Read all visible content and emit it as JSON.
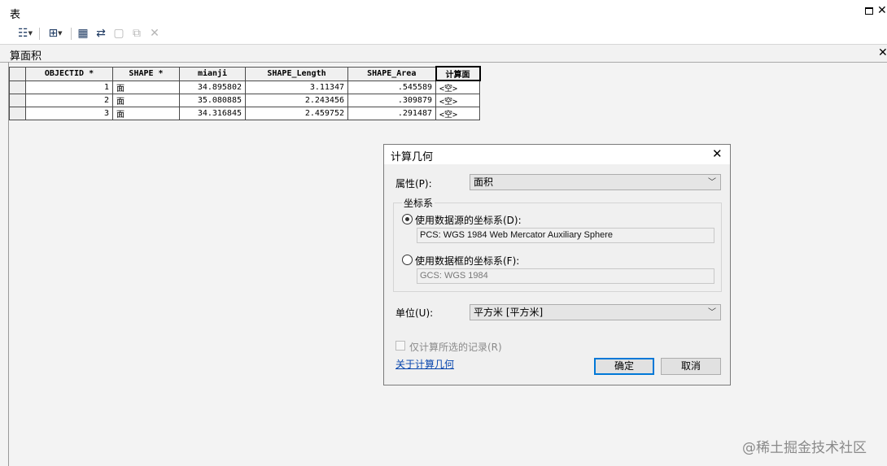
{
  "window": {
    "title": "表"
  },
  "toolbar": {
    "items": [
      {
        "name": "table-options-icon",
        "glyph": "☷",
        "dropdown": true,
        "disabled": false
      },
      {
        "name": "related-tables-icon",
        "glyph": "⊞",
        "dropdown": true,
        "disabled": false
      },
      {
        "name": "select-by-attributes-icon",
        "glyph": "▦",
        "dropdown": false,
        "disabled": false
      },
      {
        "name": "switch-selection-icon",
        "glyph": "⇄",
        "dropdown": false,
        "disabled": false
      },
      {
        "name": "clear-selection-icon",
        "glyph": "▢",
        "dropdown": false,
        "disabled": true
      },
      {
        "name": "zoom-to-selected-icon",
        "glyph": "⧉",
        "dropdown": false,
        "disabled": true
      },
      {
        "name": "delete-selected-icon",
        "glyph": "✕",
        "dropdown": false,
        "disabled": true
      }
    ]
  },
  "tab": {
    "name": "算面积"
  },
  "table": {
    "columns": [
      "OBJECTID *",
      "SHAPE *",
      "mianji",
      "SHAPE_Length",
      "SHAPE_Area",
      "计算面"
    ],
    "rows": [
      [
        "1",
        "面",
        "34.895802",
        "3.11347",
        ".545589",
        "<空>"
      ],
      [
        "2",
        "面",
        "35.080885",
        "2.243456",
        ".309879",
        "<空>"
      ],
      [
        "3",
        "面",
        "34.316845",
        "2.459752",
        ".291487",
        "<空>"
      ]
    ]
  },
  "dialog": {
    "title": "计算几何",
    "property_label": "属性(P):",
    "property_value": "面积",
    "coord_group_title": "坐标系",
    "radio_source_label": "使用数据源的坐标系(D):",
    "radio_source_value": "PCS: WGS 1984 Web Mercator Auxiliary Sphere",
    "radio_frame_label": "使用数据框的坐标系(F):",
    "radio_frame_value": "GCS: WGS 1984",
    "selected_coord": "source",
    "units_label": "单位(U):",
    "units_value": "平方米 [平方米]",
    "selected_only_label": "仅计算所选的记录(R)",
    "about_link": "关于计算几何",
    "ok_label": "确定",
    "cancel_label": "取消"
  },
  "watermark": "@稀土掘金技术社区"
}
